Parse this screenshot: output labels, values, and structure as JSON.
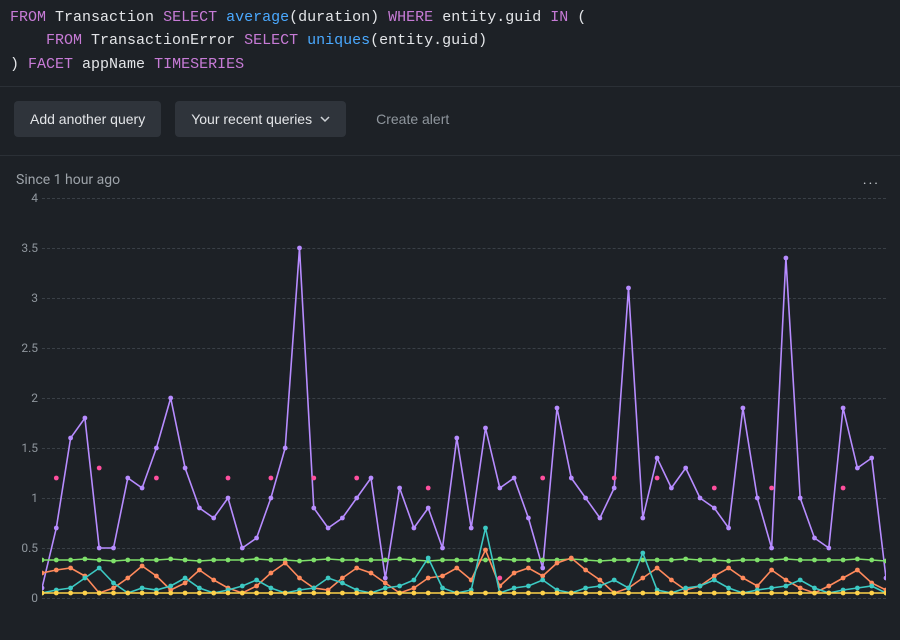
{
  "query_tokens": [
    [
      {
        "t": "FROM",
        "c": "kw"
      },
      {
        "t": " ",
        "c": "sp"
      },
      {
        "t": "Transaction",
        "c": "ident"
      },
      {
        "t": " ",
        "c": "sp"
      },
      {
        "t": "SELECT",
        "c": "kw"
      },
      {
        "t": " ",
        "c": "sp"
      },
      {
        "t": "average",
        "c": "fn"
      },
      {
        "t": "(duration)",
        "c": "paren"
      },
      {
        "t": " ",
        "c": "sp"
      },
      {
        "t": "WHERE",
        "c": "kw"
      },
      {
        "t": " ",
        "c": "sp"
      },
      {
        "t": "entity.guid",
        "c": "ident"
      },
      {
        "t": " ",
        "c": "sp"
      },
      {
        "t": "IN",
        "c": "kw"
      },
      {
        "t": " (",
        "c": "paren"
      }
    ],
    [
      {
        "t": "    ",
        "c": "sp"
      },
      {
        "t": "FROM",
        "c": "kw"
      },
      {
        "t": " ",
        "c": "sp"
      },
      {
        "t": "TransactionError",
        "c": "ident"
      },
      {
        "t": " ",
        "c": "sp"
      },
      {
        "t": "SELECT",
        "c": "kw"
      },
      {
        "t": " ",
        "c": "sp"
      },
      {
        "t": "uniques",
        "c": "fn"
      },
      {
        "t": "(entity.guid)",
        "c": "paren"
      }
    ],
    [
      {
        "t": ") ",
        "c": "paren"
      },
      {
        "t": "FACET",
        "c": "kw"
      },
      {
        "t": " ",
        "c": "sp"
      },
      {
        "t": "appName",
        "c": "ident"
      },
      {
        "t": " ",
        "c": "sp"
      },
      {
        "t": "TIMESERIES",
        "c": "kw"
      }
    ]
  ],
  "buttons": {
    "add_query": "Add another query",
    "recent_queries": "Your recent queries",
    "create_alert": "Create alert"
  },
  "chart": {
    "timerange_label": "Since 1 hour ago",
    "menu_glyph": "..."
  },
  "chart_data": {
    "type": "line",
    "title": "",
    "xlabel": "",
    "ylabel": "",
    "ylim": [
      0,
      4
    ],
    "y_ticks": [
      0,
      0.5,
      1,
      1.5,
      2,
      2.5,
      3,
      3.5,
      4
    ],
    "x_index": [
      0,
      1,
      2,
      3,
      4,
      5,
      6,
      7,
      8,
      9,
      10,
      11,
      12,
      13,
      14,
      15,
      16,
      17,
      18,
      19,
      20,
      21,
      22,
      23,
      24,
      25,
      26,
      27,
      28,
      29,
      30,
      31,
      32,
      33,
      34,
      35,
      36,
      37,
      38,
      39,
      40,
      41,
      42,
      43,
      44,
      45,
      46,
      47,
      48,
      49,
      50,
      51,
      52,
      53,
      54,
      55,
      56,
      57,
      58,
      59
    ],
    "series": [
      {
        "name": "series-purple",
        "color": "#b78cff",
        "values": [
          0.1,
          0.7,
          1.6,
          1.8,
          0.5,
          0.5,
          1.2,
          1.1,
          1.5,
          2.0,
          1.3,
          0.9,
          0.8,
          1.0,
          0.5,
          0.6,
          1.0,
          1.5,
          3.5,
          0.9,
          0.7,
          0.8,
          1.0,
          1.2,
          0.2,
          1.1,
          0.7,
          0.9,
          0.5,
          1.6,
          0.7,
          1.7,
          1.1,
          1.2,
          0.8,
          0.3,
          1.9,
          1.2,
          1.0,
          0.8,
          1.1,
          3.1,
          0.8,
          1.4,
          1.1,
          1.3,
          1.0,
          0.9,
          0.7,
          1.9,
          1.0,
          0.5,
          3.4,
          1.0,
          0.6,
          0.5,
          1.9,
          1.3,
          1.4,
          0.2
        ]
      },
      {
        "name": "series-pink",
        "color": "#ff4f9e",
        "points_only": true,
        "values": [
          null,
          1.2,
          null,
          null,
          1.3,
          null,
          null,
          null,
          1.2,
          null,
          null,
          null,
          null,
          1.2,
          null,
          null,
          1.2,
          null,
          null,
          1.2,
          null,
          null,
          1.2,
          null,
          null,
          null,
          null,
          1.1,
          null,
          null,
          null,
          null,
          0.2,
          null,
          null,
          1.2,
          null,
          null,
          null,
          null,
          1.2,
          null,
          null,
          1.2,
          null,
          null,
          null,
          1.1,
          null,
          null,
          null,
          1.1,
          null,
          null,
          null,
          null,
          1.1,
          null,
          null,
          null
        ]
      },
      {
        "name": "series-green",
        "color": "#7fe06a",
        "values": [
          0.38,
          0.38,
          0.38,
          0.39,
          0.38,
          0.37,
          0.38,
          0.38,
          0.38,
          0.39,
          0.38,
          0.37,
          0.38,
          0.38,
          0.38,
          0.39,
          0.38,
          0.38,
          0.37,
          0.38,
          0.39,
          0.38,
          0.38,
          0.38,
          0.38,
          0.39,
          0.38,
          0.37,
          0.38,
          0.38,
          0.38,
          0.38,
          0.39,
          0.38,
          0.38,
          0.38,
          0.38,
          0.39,
          0.38,
          0.37,
          0.38,
          0.38,
          0.38,
          0.38,
          0.38,
          0.39,
          0.38,
          0.38,
          0.37,
          0.38,
          0.38,
          0.38,
          0.39,
          0.38,
          0.38,
          0.38,
          0.38,
          0.39,
          0.38,
          0.37
        ]
      },
      {
        "name": "series-orange",
        "color": "#ff8a5c",
        "values": [
          0.25,
          0.28,
          0.3,
          0.22,
          0.05,
          0.1,
          0.2,
          0.32,
          0.22,
          0.08,
          0.15,
          0.28,
          0.18,
          0.1,
          0.05,
          0.12,
          0.25,
          0.35,
          0.2,
          0.1,
          0.08,
          0.2,
          0.3,
          0.25,
          0.15,
          0.05,
          0.1,
          0.2,
          0.22,
          0.3,
          0.18,
          0.48,
          0.12,
          0.25,
          0.3,
          0.22,
          0.35,
          0.4,
          0.28,
          0.18,
          0.05,
          0.1,
          0.2,
          0.3,
          0.18,
          0.08,
          0.12,
          0.22,
          0.3,
          0.2,
          0.12,
          0.28,
          0.18,
          0.1,
          0.05,
          0.12,
          0.2,
          0.28,
          0.15,
          0.08
        ]
      },
      {
        "name": "series-teal",
        "color": "#3cc9c3",
        "values": [
          0.05,
          0.08,
          0.1,
          0.2,
          0.3,
          0.15,
          0.05,
          0.1,
          0.08,
          0.12,
          0.2,
          0.1,
          0.05,
          0.08,
          0.12,
          0.18,
          0.1,
          0.05,
          0.08,
          0.1,
          0.2,
          0.15,
          0.08,
          0.05,
          0.1,
          0.12,
          0.18,
          0.4,
          0.1,
          0.05,
          0.08,
          0.7,
          0.05,
          0.1,
          0.12,
          0.18,
          0.08,
          0.05,
          0.1,
          0.12,
          0.18,
          0.1,
          0.45,
          0.08,
          0.05,
          0.1,
          0.12,
          0.18,
          0.1,
          0.05,
          0.08,
          0.1,
          0.12,
          0.18,
          0.1,
          0.05,
          0.08,
          0.1,
          0.12,
          0.05
        ]
      },
      {
        "name": "series-yellow",
        "color": "#ffd24a",
        "values": [
          0.05,
          0.05,
          0.05,
          0.05,
          0.05,
          0.05,
          0.05,
          0.05,
          0.05,
          0.05,
          0.05,
          0.05,
          0.05,
          0.05,
          0.05,
          0.05,
          0.05,
          0.05,
          0.05,
          0.05,
          0.05,
          0.05,
          0.05,
          0.05,
          0.05,
          0.05,
          0.05,
          0.05,
          0.05,
          0.05,
          0.05,
          0.05,
          0.05,
          0.05,
          0.05,
          0.05,
          0.05,
          0.05,
          0.05,
          0.05,
          0.05,
          0.05,
          0.05,
          0.05,
          0.05,
          0.05,
          0.05,
          0.05,
          0.05,
          0.05,
          0.05,
          0.05,
          0.05,
          0.05,
          0.05,
          0.05,
          0.05,
          0.05,
          0.05,
          0.05
        ]
      }
    ]
  }
}
